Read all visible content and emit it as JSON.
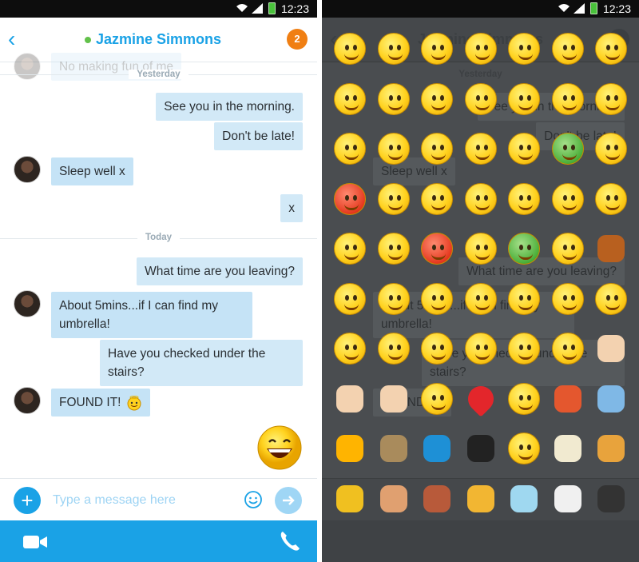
{
  "status_bar": {
    "time": "12:23"
  },
  "header": {
    "contact_name": "Jazmine Simmons",
    "unread_count": "2"
  },
  "messages": [
    {
      "text": "No making fun of me",
      "direction": "in"
    },
    {
      "text": "See you in the morning.",
      "direction": "out"
    },
    {
      "text": "Don't be late!",
      "direction": "out"
    },
    {
      "text": "Sleep well x",
      "direction": "in"
    },
    {
      "text": "x",
      "direction": "out"
    },
    {
      "text": "What time are you leaving?",
      "direction": "out"
    },
    {
      "text": "About 5mins...if I can find my umbrella!",
      "direction": "in"
    },
    {
      "text": "Have you checked under the stairs?",
      "direction": "out"
    },
    {
      "text": "FOUND IT!",
      "direction": "in"
    }
  ],
  "dividers": {
    "yesterday": "Yesterday",
    "today": "Today"
  },
  "composer": {
    "placeholder": "Type a message here"
  },
  "colors": {
    "accent": "#1aa2e6",
    "badge": "#f07f13",
    "bubble": "#d2e9f7",
    "presence": "#62c14a"
  },
  "emoji_picker": {
    "icons": [
      "smile-icon",
      "worried-icon",
      "laugh-icon",
      "cool-sunglasses-icon",
      "surprised-icon",
      "wink-icon",
      "crying-icon",
      "sweating-icon",
      "speechless-icon",
      "kiss-icon",
      "tongue-out-icon",
      "blush-icon",
      "wondering-icon",
      "sleepy-icon",
      "dull-icon",
      "in-love-icon",
      "evil-grin-icon",
      "talking-icon",
      "yawn-icon",
      "puke-icon",
      "doh-icon",
      "angry-icon",
      "it-wasnt-me-icon",
      "party-icon",
      "worried-icon",
      "mmm-icon",
      "nerd-icon",
      "lips-sealed-icon",
      "hi-icon",
      "call-icon",
      "devil-icon",
      "angel-icon",
      "envy-icon",
      "wait-icon",
      "bear-icon",
      "make-up-icon",
      "giggle-icon",
      "clapping-icon",
      "thinking-icon",
      "bow-icon",
      "rofl-icon",
      "whew-icon",
      "happy-icon",
      "smirk-icon",
      "nod-icon",
      "shake-icon",
      "waiting-icon",
      "emo-icon",
      "thumbs-up-icon",
      "thumbs-down-icon",
      "handshake-icon",
      "facepalm-icon",
      "heart-icon",
      "fingers-crossed-icon",
      "flower-icon",
      "rain-icon",
      "sun-icon",
      "tumbleweed-icon",
      "music-icon",
      "bandit-icon",
      "tmi-icon",
      "coffee-icon",
      "pizza-icon",
      "cash-icon",
      "muscle-icon",
      "cake-icon",
      "beer-icon",
      "drink-icon",
      "dance-icon",
      "ninja-icon"
    ]
  }
}
